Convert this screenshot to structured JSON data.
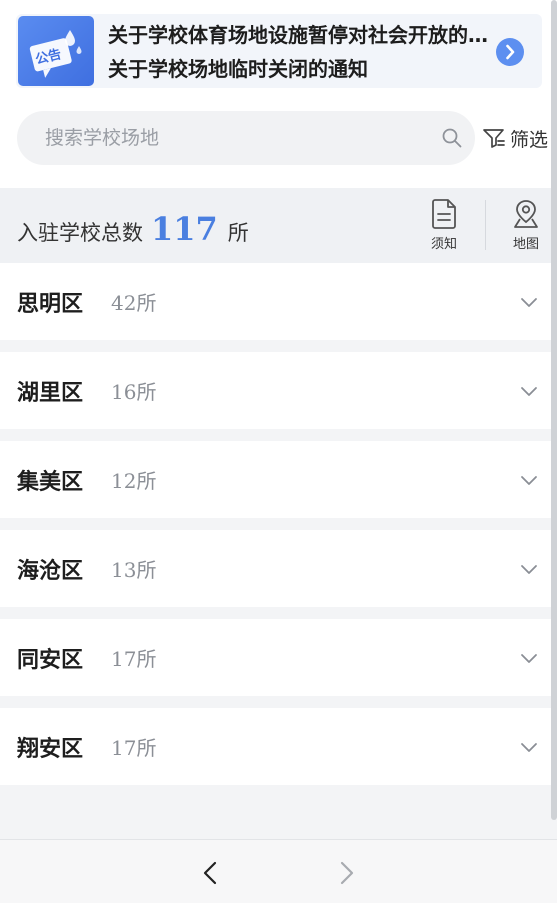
{
  "notice": {
    "badge_text": "公告",
    "lines": [
      "关于学校体育场地设施暂停对社会开放的通知",
      "关于学校场地临时关闭的通知"
    ]
  },
  "search": {
    "placeholder": "搜索学校场地",
    "value": ""
  },
  "filter": {
    "label": "筛选"
  },
  "stats": {
    "label": "入驻学校总数",
    "count": "117",
    "unit": "所"
  },
  "tools": [
    {
      "label": "须知",
      "icon": "document-icon"
    },
    {
      "label": "地图",
      "icon": "map-pin-icon"
    }
  ],
  "districts": [
    {
      "name": "思明区",
      "count": "42所"
    },
    {
      "name": "湖里区",
      "count": "16所"
    },
    {
      "name": "集美区",
      "count": "12所"
    },
    {
      "name": "海沧区",
      "count": "13所"
    },
    {
      "name": "同安区",
      "count": "17所"
    },
    {
      "name": "翔安区",
      "count": "17所"
    }
  ],
  "nav": {
    "back_icon": "chevron-left-icon",
    "forward_icon": "chevron-right-icon"
  },
  "colors": {
    "accent": "#4a7fe0",
    "badge": "#5a8cf0",
    "background": "#f3f4f6"
  }
}
